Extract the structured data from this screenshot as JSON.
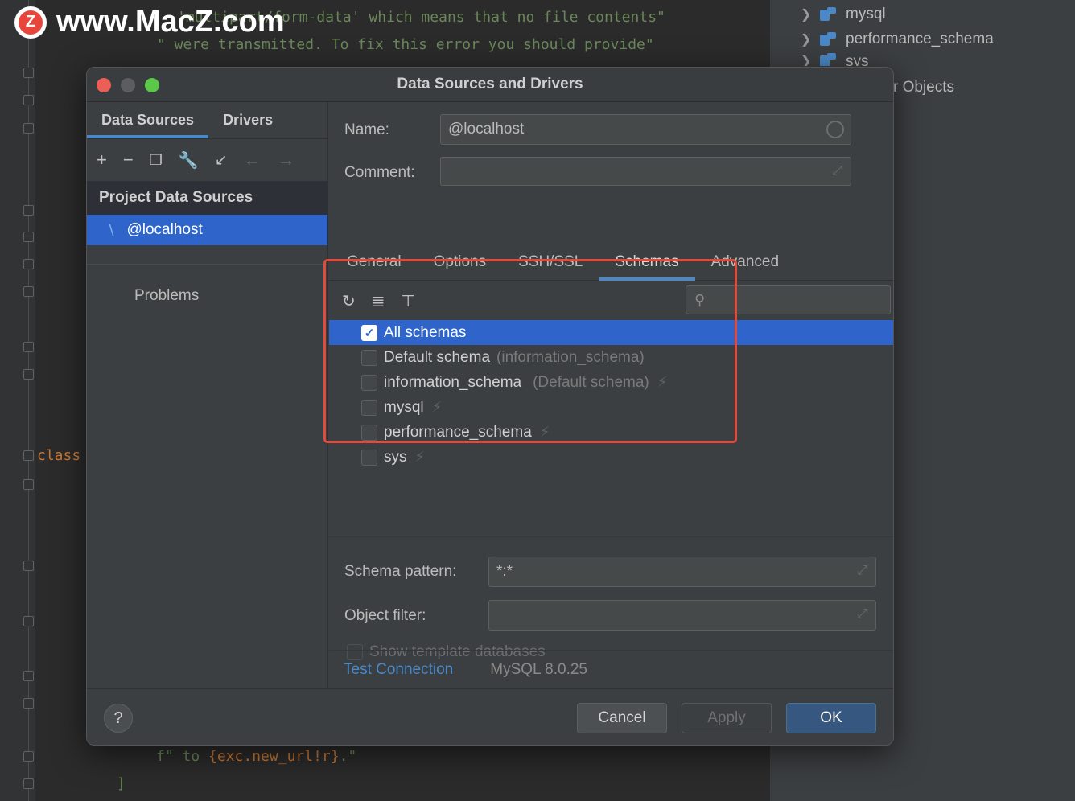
{
  "watermark": {
    "logo_letter": "Z",
    "text": "www.MacZ.com"
  },
  "background_code": {
    "line1": "'multipart/form-data' which means that no file contents\"",
    "line2": "\" were transmitted. To fix this error you should provide\"",
    "class_kw": "class",
    "bottom_f": "f\" to ",
    "bottom_expr": "{exc.new_url!r}",
    "bottom_end": ".\"",
    "bracket": "]"
  },
  "right_tree": {
    "items": [
      {
        "label": "mysql"
      },
      {
        "label": "performance_schema"
      },
      {
        "label": "sys"
      }
    ],
    "objects_label": "r Objects"
  },
  "dialog": {
    "title": "Data Sources and Drivers",
    "left_tabs": [
      "Data Sources",
      "Drivers"
    ],
    "toolbar_icons": [
      "plus-icon",
      "minus-icon",
      "duplicate-icon",
      "wrench-icon",
      "import-icon",
      "arrow-left-icon",
      "arrow-right-icon"
    ],
    "project_header": "Project Data Sources",
    "selected_source": "@localhost",
    "problems": "Problems",
    "name_label": "Name:",
    "name_value": "@localhost",
    "comment_label": "Comment:",
    "comment_value": "",
    "sub_tabs": [
      "General",
      "Options",
      "SSH/SSL",
      "Schemas",
      "Advanced"
    ],
    "active_sub_tab": "Schemas",
    "schemas": [
      {
        "label": "All schemas",
        "checked": true,
        "hint": "",
        "bolt": false
      },
      {
        "label": "Default schema",
        "checked": false,
        "hint": "(information_schema)",
        "bolt": false
      },
      {
        "label": "information_schema",
        "checked": false,
        "hint": "(Default schema)",
        "bolt": true
      },
      {
        "label": "mysql",
        "checked": false,
        "hint": "",
        "bolt": true
      },
      {
        "label": "performance_schema",
        "checked": false,
        "hint": "",
        "bolt": true
      },
      {
        "label": "sys",
        "checked": false,
        "hint": "",
        "bolt": true
      }
    ],
    "schema_pattern_label": "Schema pattern:",
    "schema_pattern_value": "*:*",
    "object_filter_label": "Object filter:",
    "object_filter_value": "",
    "show_template_label": "Show template databases",
    "test_connection": "Test Connection",
    "version": "MySQL 8.0.25",
    "help": "?",
    "cancel": "Cancel",
    "apply": "Apply",
    "ok": "OK"
  },
  "colors": {
    "accent": "#2f65ca",
    "highlight_box": "#e14b3c",
    "link": "#4a88c7"
  }
}
